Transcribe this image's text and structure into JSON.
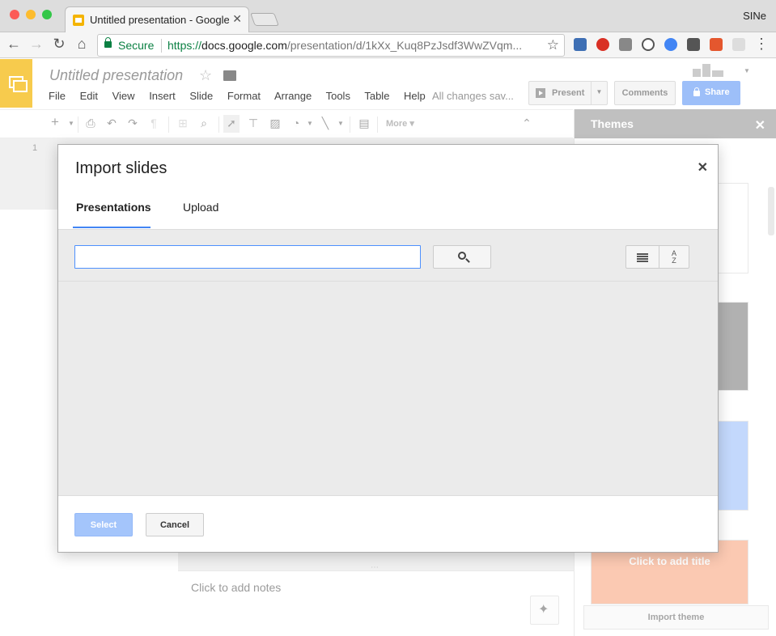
{
  "browser": {
    "tab_title": "Untitled presentation - Google Slides",
    "profile_name": "SINe",
    "secure_label": "Secure",
    "url_scheme": "https://",
    "url_host": "docs.google.com",
    "url_path": "/presentation/d/1kXx_Kuq8PzJsdf3WwZVqm..."
  },
  "app": {
    "doc_title": "Untitled presentation",
    "menu": [
      "File",
      "Edit",
      "View",
      "Insert",
      "Slide",
      "Format",
      "Arrange",
      "Tools",
      "Table",
      "Help"
    ],
    "save_status": "All changes sav...",
    "present_label": "Present",
    "comments_label": "Comments",
    "share_label": "Share",
    "toolbar_more": "More",
    "slide_number": "1",
    "notes_placeholder": "Click to add notes"
  },
  "themes": {
    "title": "Themes",
    "click_to_add_title": "Click to add title",
    "import_theme_label": "Import theme"
  },
  "dialog": {
    "title": "Import slides",
    "tabs": [
      "Presentations",
      "Upload"
    ],
    "active_tab": "Presentations",
    "search_value": "",
    "sort_label_top": "A",
    "sort_label_bottom": "Z",
    "select_label": "Select",
    "cancel_label": "Cancel"
  },
  "colors": {
    "slides_yellow": "#f7cb4d",
    "accent_blue": "#4285f4",
    "share_blue": "#9dbff9",
    "secure_green": "#0b8043",
    "themes_header_gray": "#9e9e9e"
  }
}
